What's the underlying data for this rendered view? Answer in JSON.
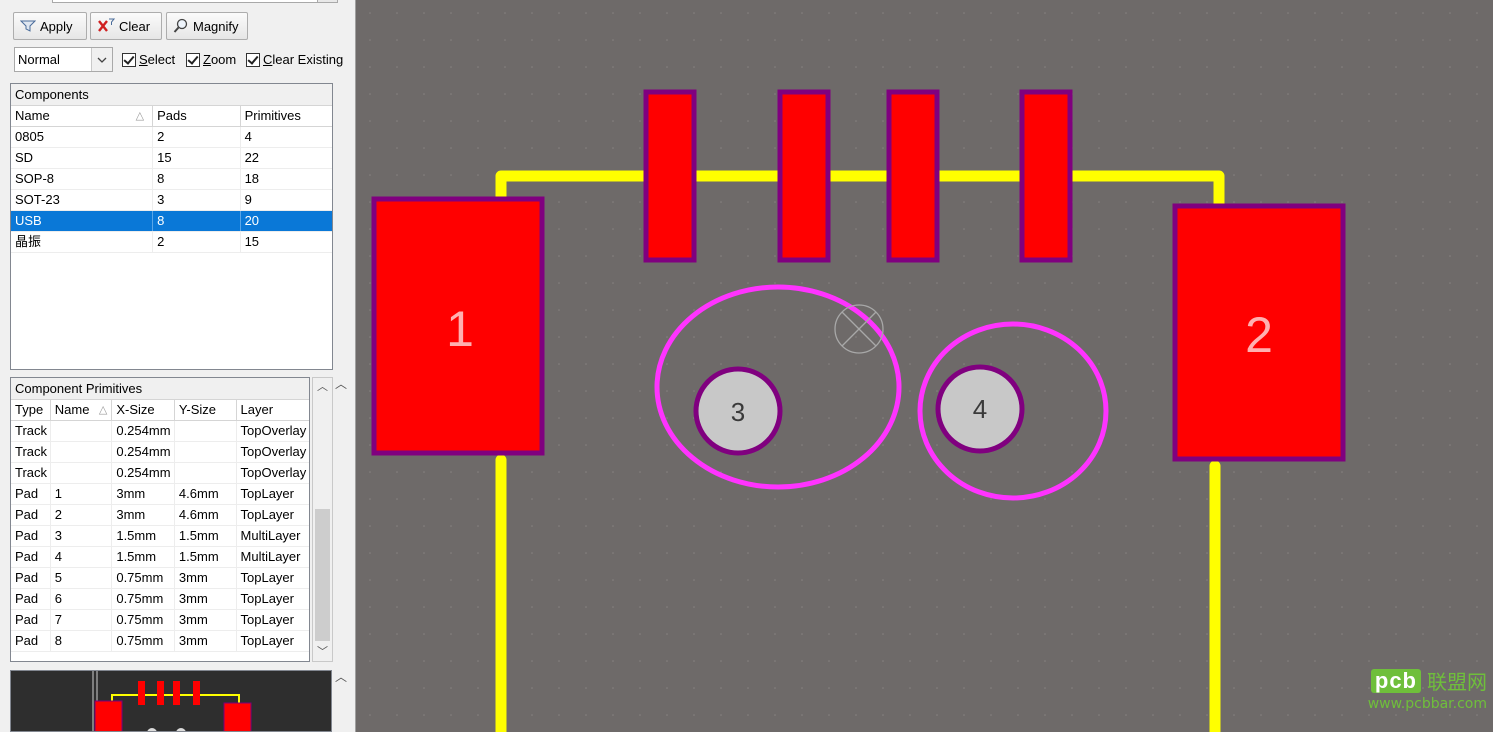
{
  "toolbar": {
    "apply_label": "Apply",
    "clear_label": "Clear",
    "magnify_label": "Magnify"
  },
  "options": {
    "mode_value": "Normal",
    "select_label": "Select",
    "zoom_label": "Zoom",
    "clear_existing_label": "Clear Existing",
    "select_checked": true,
    "zoom_checked": true,
    "clear_existing_checked": true
  },
  "components": {
    "title": "Components",
    "headers": [
      "Name",
      "Pads",
      "Primitives"
    ],
    "rows": [
      {
        "name": "0805",
        "pads": "2",
        "primitives": "4"
      },
      {
        "name": "SD",
        "pads": "15",
        "primitives": "22"
      },
      {
        "name": "SOP-8",
        "pads": "8",
        "primitives": "18"
      },
      {
        "name": "SOT-23",
        "pads": "3",
        "primitives": "9"
      },
      {
        "name": "USB",
        "pads": "8",
        "primitives": "20",
        "selected": true
      },
      {
        "name": "晶振",
        "pads": "2",
        "primitives": "15"
      }
    ]
  },
  "primitives": {
    "title": "Component Primitives",
    "headers": [
      "Type",
      "Name",
      "X-Size",
      "Y-Size",
      "Layer"
    ],
    "rows": [
      {
        "type": "Track",
        "name": "",
        "xsize": "0.254mm",
        "ysize": "",
        "layer": "TopOverlay"
      },
      {
        "type": "Track",
        "name": "",
        "xsize": "0.254mm",
        "ysize": "",
        "layer": "TopOverlay"
      },
      {
        "type": "Track",
        "name": "",
        "xsize": "0.254mm",
        "ysize": "",
        "layer": "TopOverlay"
      },
      {
        "type": "Pad",
        "name": "1",
        "xsize": "3mm",
        "ysize": "4.6mm",
        "layer": "TopLayer"
      },
      {
        "type": "Pad",
        "name": "2",
        "xsize": "3mm",
        "ysize": "4.6mm",
        "layer": "TopLayer"
      },
      {
        "type": "Pad",
        "name": "3",
        "xsize": "1.5mm",
        "ysize": "1.5mm",
        "layer": "MultiLayer"
      },
      {
        "type": "Pad",
        "name": "4",
        "xsize": "1.5mm",
        "ysize": "1.5mm",
        "layer": "MultiLayer"
      },
      {
        "type": "Pad",
        "name": "5",
        "xsize": "0.75mm",
        "ysize": "3mm",
        "layer": "TopLayer"
      },
      {
        "type": "Pad",
        "name": "6",
        "xsize": "0.75mm",
        "ysize": "3mm",
        "layer": "TopLayer"
      },
      {
        "type": "Pad",
        "name": "7",
        "xsize": "0.75mm",
        "ysize": "3mm",
        "layer": "TopLayer"
      },
      {
        "type": "Pad",
        "name": "8",
        "xsize": "0.75mm",
        "ysize": "3mm",
        "layer": "TopLayer"
      }
    ]
  },
  "canvas": {
    "pad_labels": {
      "p1": "1",
      "p2": "2",
      "p3": "3",
      "p4": "4"
    },
    "colors": {
      "background": "#6e6a69",
      "pad_fill": "#ff0000",
      "pad_outline": "#80007f",
      "overlay": "#ffff00",
      "mech_ring": "#ff33ff",
      "thru_pad": "#c8c8c8"
    }
  },
  "watermark": {
    "logo": "pcb",
    "cn": "联盟网",
    "url": "www.pcbbar.com"
  }
}
